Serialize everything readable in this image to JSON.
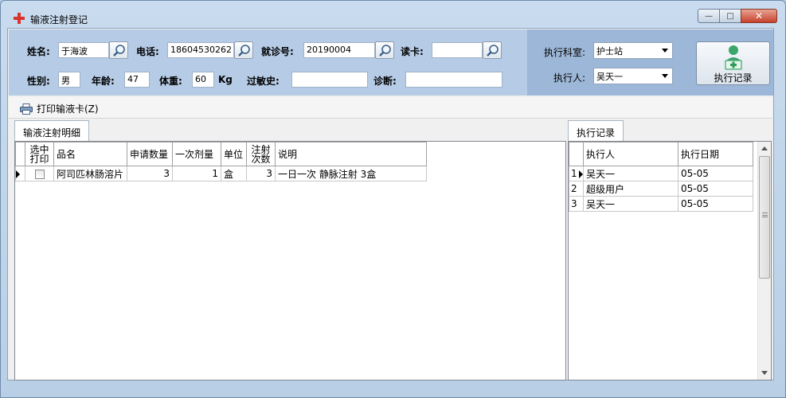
{
  "window": {
    "title": "输液注射登记",
    "buttons": {
      "minimize": "—",
      "maximize": "□",
      "close": "✕"
    }
  },
  "form": {
    "name_label": "姓名:",
    "name_value": "于海波",
    "phone_label": "电话:",
    "phone_value": "18604530262",
    "visit_label": "就诊号:",
    "visit_value": "20190004",
    "card_label": "读卡:",
    "card_value": "",
    "gender_label": "性别:",
    "gender_value": "男",
    "age_label": "年龄:",
    "age_value": "47",
    "weight_label": "体重:",
    "weight_value": "60",
    "weight_unit": "Kg",
    "allergy_label": "过敏史:",
    "allergy_value": "",
    "diagnosis_label": "诊断:",
    "diagnosis_value": ""
  },
  "exec": {
    "dept_label": "执行科室:",
    "dept_value": "护士站",
    "person_label": "执行人:",
    "person_value": "吴天一",
    "record_button": "执行记录"
  },
  "toolbar": {
    "print_label": "打印输液卡(Z)"
  },
  "left_tab": {
    "label": "输液注射明细"
  },
  "detail_table": {
    "headers": {
      "select": "选中\n打印",
      "name": "品名",
      "qty": "申请数量",
      "dose": "一次剂量",
      "unit": "单位",
      "times": "注射\n次数",
      "note": "说明"
    },
    "rows": [
      {
        "name": "阿司匹林肠溶片",
        "qty": "3",
        "dose": "1",
        "unit": "盒",
        "times": "3",
        "note": "一日一次 静脉注射 3盒"
      }
    ]
  },
  "right_tab": {
    "label": "执行记录"
  },
  "record_table": {
    "headers": {
      "person": "执行人",
      "date": "执行日期"
    },
    "rows": [
      {
        "idx": "1",
        "person": "吴天一",
        "date": "05-05"
      },
      {
        "idx": "2",
        "person": "超级用户",
        "date": "05-05"
      },
      {
        "idx": "3",
        "person": "吴天一",
        "date": "05-05"
      }
    ]
  },
  "colors": {
    "form_bg": "#b6cbe5",
    "exec_bg": "#9db7d8",
    "title_icon": "#d9342b",
    "close_button": "#c7412c"
  },
  "icons": [
    "app-cross-icon",
    "search-icon",
    "printer-icon",
    "nurse-add-icon",
    "dropdown-arrow-icon"
  ]
}
